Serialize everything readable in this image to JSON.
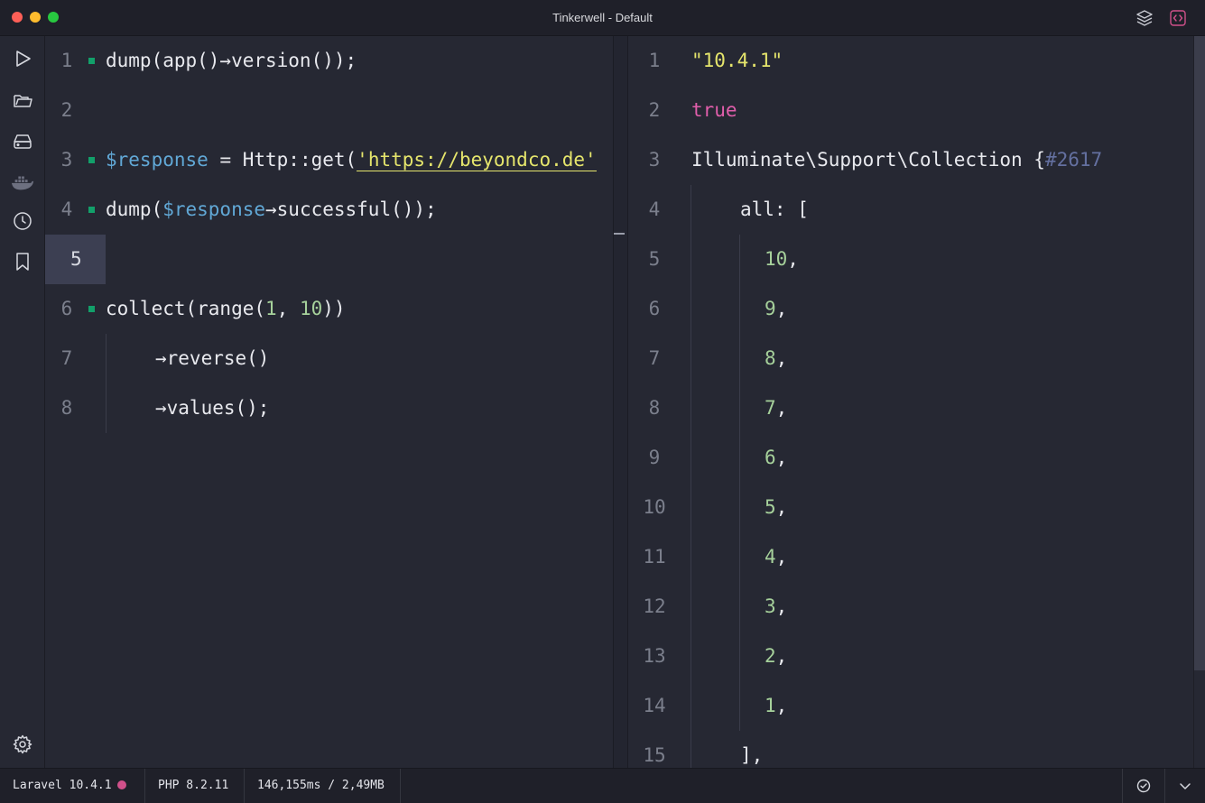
{
  "window": {
    "title": "Tinkerwell - Default"
  },
  "icons": {
    "titlebar": [
      "layers-icon",
      "code-brackets-icon"
    ],
    "sidebar": [
      "run-icon",
      "folder-icon",
      "database-icon",
      "docker-icon",
      "history-icon",
      "bookmark-icon",
      "settings-icon"
    ],
    "status": [
      "check-circle-icon",
      "chevron-down-icon"
    ]
  },
  "colors": {
    "background": "#262833",
    "accent_marker": "#12a06a",
    "variable": "#61a8d6",
    "string": "#e5e56c",
    "number": "#a6d19b",
    "boolean": "#e05eab",
    "code_icon": "#d0508a"
  },
  "editor": {
    "active_line": 5,
    "lines": [
      {
        "n": "1",
        "parts": [
          {
            "t": "dump(app()→version());",
            "c": "plain"
          }
        ],
        "marker": true
      },
      {
        "n": "2",
        "parts": [],
        "marker": false
      },
      {
        "n": "3",
        "parts": [
          {
            "t": "$response",
            "c": "var"
          },
          {
            "t": " = Http::get(",
            "c": "plain"
          },
          {
            "t": "'https://beyondco.de'",
            "c": "str"
          }
        ],
        "marker": true
      },
      {
        "n": "4",
        "parts": [
          {
            "t": "dump(",
            "c": "plain"
          },
          {
            "t": "$response",
            "c": "var"
          },
          {
            "t": "→successful());",
            "c": "plain"
          }
        ],
        "marker": true
      },
      {
        "n": "5",
        "parts": [],
        "marker": false
      },
      {
        "n": "6",
        "parts": [
          {
            "t": "collect(range(",
            "c": "plain"
          },
          {
            "t": "1",
            "c": "num"
          },
          {
            "t": ", ",
            "c": "plain"
          },
          {
            "t": "10",
            "c": "num"
          },
          {
            "t": "))",
            "c": "plain"
          }
        ],
        "marker": true
      },
      {
        "n": "7",
        "parts": [
          {
            "t": "→reverse()",
            "c": "plain"
          }
        ],
        "marker": false,
        "indent": true
      },
      {
        "n": "8",
        "parts": [
          {
            "t": "→values();",
            "c": "plain"
          }
        ],
        "marker": false,
        "indent": true
      }
    ]
  },
  "output": {
    "lines": [
      {
        "n": "1",
        "indent": 0,
        "parts": [
          {
            "t": "\"10.4.1\"",
            "c": "ostr"
          }
        ]
      },
      {
        "n": "2",
        "indent": 0,
        "parts": [
          {
            "t": "true",
            "c": "obool"
          }
        ]
      },
      {
        "n": "3",
        "indent": 0,
        "parts": [
          {
            "t": "Illuminate\\Support\\Collection {",
            "c": "plain"
          },
          {
            "t": "#2617",
            "c": "ohash"
          }
        ]
      },
      {
        "n": "4",
        "indent": 1,
        "parts": [
          {
            "t": "all: [",
            "c": "plain"
          }
        ]
      },
      {
        "n": "5",
        "indent": 2,
        "parts": [
          {
            "t": "10",
            "c": "onum"
          },
          {
            "t": ",",
            "c": "plain"
          }
        ]
      },
      {
        "n": "6",
        "indent": 2,
        "parts": [
          {
            "t": "9",
            "c": "onum"
          },
          {
            "t": ",",
            "c": "plain"
          }
        ]
      },
      {
        "n": "7",
        "indent": 2,
        "parts": [
          {
            "t": "8",
            "c": "onum"
          },
          {
            "t": ",",
            "c": "plain"
          }
        ]
      },
      {
        "n": "8",
        "indent": 2,
        "parts": [
          {
            "t": "7",
            "c": "onum"
          },
          {
            "t": ",",
            "c": "plain"
          }
        ]
      },
      {
        "n": "9",
        "indent": 2,
        "parts": [
          {
            "t": "6",
            "c": "onum"
          },
          {
            "t": ",",
            "c": "plain"
          }
        ]
      },
      {
        "n": "10",
        "indent": 2,
        "parts": [
          {
            "t": "5",
            "c": "onum"
          },
          {
            "t": ",",
            "c": "plain"
          }
        ]
      },
      {
        "n": "11",
        "indent": 2,
        "parts": [
          {
            "t": "4",
            "c": "onum"
          },
          {
            "t": ",",
            "c": "plain"
          }
        ]
      },
      {
        "n": "12",
        "indent": 2,
        "parts": [
          {
            "t": "3",
            "c": "onum"
          },
          {
            "t": ",",
            "c": "plain"
          }
        ]
      },
      {
        "n": "13",
        "indent": 2,
        "parts": [
          {
            "t": "2",
            "c": "onum"
          },
          {
            "t": ",",
            "c": "plain"
          }
        ]
      },
      {
        "n": "14",
        "indent": 2,
        "parts": [
          {
            "t": "1",
            "c": "onum"
          },
          {
            "t": ",",
            "c": "plain"
          }
        ]
      },
      {
        "n": "15",
        "indent": 1,
        "parts": [
          {
            "t": "],",
            "c": "plain"
          }
        ]
      }
    ]
  },
  "status": {
    "framework": "Laravel 10.4.1",
    "php": "PHP 8.2.11",
    "timing": "146,155ms / 2,49MB"
  }
}
